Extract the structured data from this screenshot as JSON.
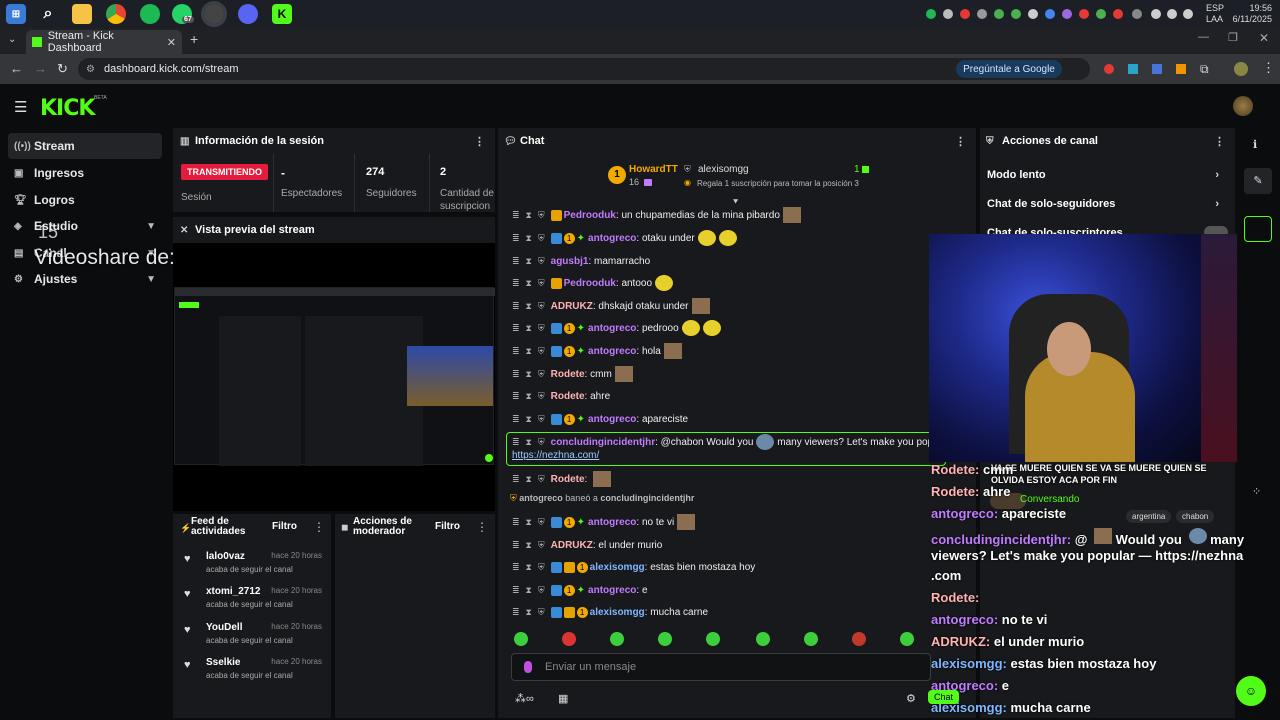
{
  "taskbar": {
    "apps": [
      "windows-logo",
      "search-icon",
      "file-explorer-icon",
      "chrome-icon",
      "spotify-icon",
      "whatsapp-icon",
      "obs-icon",
      "discord-icon",
      "kick-icon"
    ],
    "whatsapp_badge": "67",
    "lang_line1": "ESP",
    "lang_line2": "LAA",
    "time": "19:56",
    "date": "6/11/2025"
  },
  "browser": {
    "tab_title": "Stream - Kick Dashboard",
    "url": "dashboard.kick.com/stream",
    "google_button": "Pregúntale a Google"
  },
  "sidebar": {
    "logo": "KICK",
    "beta": "BETA",
    "items": [
      {
        "label": "Stream",
        "icon": "broadcast-icon"
      },
      {
        "label": "Ingresos",
        "icon": "revenue-icon"
      },
      {
        "label": "Logros",
        "icon": "trophy-icon"
      },
      {
        "label": "Estudio",
        "icon": "studio-icon"
      },
      {
        "label": "Canal",
        "icon": "channel-icon"
      },
      {
        "label": "Ajustes",
        "icon": "settings-icon"
      }
    ],
    "overlay_text": "Videoshare de:",
    "overlay_num": "15"
  },
  "session": {
    "title": "Información de la sesión",
    "live_badge": "TRANSMITIENDO",
    "session_label": "Sesión",
    "spectators_value": "-",
    "spectators_label": "Espectadores",
    "followers_value": "274",
    "followers_label": "Seguidores",
    "subs_value": "2",
    "subs_label_1": "Cantidad de",
    "subs_label_2": "suscripcion"
  },
  "preview": {
    "title": "Vista previa del stream"
  },
  "feed": {
    "title_1": "Feed de",
    "title_2": "actividades",
    "filter": "Filtro",
    "items": [
      {
        "name": "lalo0vaz",
        "time": "hace 20 horas",
        "desc": "acaba de seguir el canal"
      },
      {
        "name": "xtomi_2712",
        "time": "hace 20 horas",
        "desc": "acaba de seguir el canal"
      },
      {
        "name": "YouDell",
        "time": "hace 20 horas",
        "desc": "acaba de seguir el canal"
      },
      {
        "name": "Sselkie",
        "time": "hace 20 horas",
        "desc": "acaba de seguir el canal"
      }
    ]
  },
  "modactions": {
    "title_1": "Acciones de",
    "title_2": "moderador",
    "filter": "Filtro"
  },
  "chat": {
    "title": "Chat",
    "top_gifter": {
      "rank": "1",
      "name": "HowardTT",
      "count": "16",
      "name2": "alexisomgg",
      "count2": "1",
      "promo": "Regala 1 suscripción para tomar la posición 3"
    },
    "messages": [
      {
        "user": "Pedrooduk",
        "color": "#c17bff",
        "text": "un chupamedias de la mina pibardo"
      },
      {
        "user": "antogreco",
        "color": "#c17bff",
        "text": "otaku under"
      },
      {
        "user": "agusbj1",
        "color": "#c17bff",
        "text": "mamarracho"
      },
      {
        "user": "Pedrooduk",
        "color": "#c17bff",
        "text": "antooo"
      },
      {
        "user": "ADRUKZ",
        "color": "#ffb3b3",
        "text": "dhskajd otaku under"
      },
      {
        "user": "antogreco",
        "color": "#c17bff",
        "text": "pedrooo"
      },
      {
        "user": "antogreco",
        "color": "#c17bff",
        "text": "hola"
      },
      {
        "user": "Rodete",
        "color": "#ffb3b3",
        "text": "cmm"
      },
      {
        "user": "Rodete",
        "color": "#ffb3b3",
        "text": "ahre"
      },
      {
        "user": "antogreco",
        "color": "#c17bff",
        "text": "apareciste"
      },
      {
        "user": "concludingincidentjhr",
        "color": "#c17bff",
        "text": "@chabon Would you",
        "text2": "many viewers? Let's make you popular —",
        "link": "https://nezhna.com/"
      },
      {
        "user": "Rodete",
        "color": "#ffb3b3",
        "text": ""
      },
      {
        "user": "antogreco",
        "color": "#c17bff",
        "text": "no te vi"
      },
      {
        "user": "ADRUKZ",
        "color": "#ffb3b3",
        "text": "el under murio"
      },
      {
        "user": "alexisomgg",
        "color": "#7fb7ff",
        "text": "estas bien mostaza hoy"
      },
      {
        "user": "antogreco",
        "color": "#c17bff",
        "text": "e"
      },
      {
        "user": "alexisomgg",
        "color": "#7fb7ff",
        "text": "mucha carne"
      }
    ],
    "ban_actor": "antogreco",
    "ban_text": "baneó a",
    "ban_target": "concludingincidentjhr",
    "input_placeholder": "Enviar un mensaje"
  },
  "actions": {
    "title": "Acciones de canal",
    "items": [
      "Modo lento",
      "Chat de solo-seguidores",
      "Chat de solo-suscriptores"
    ]
  },
  "overlay": {
    "caption_1": "VA SE MUERE QUIEN SE VA SE MUERE QUIEN SE",
    "caption_2": "OLVIDA ESTOY ACA POR FIN",
    "status": "Conversando",
    "tags": [
      "argentina",
      "chabon"
    ],
    "chat_btn": "Chat",
    "lines": [
      {
        "user": "Rodete:",
        "text": "cmm",
        "color": "#ffb3b3"
      },
      {
        "user": "Rodete:",
        "text": "ahre",
        "color": "#ffb3b3"
      },
      {
        "user": "antogreco:",
        "text": "apareciste",
        "color": "#c17bff"
      },
      {
        "user": "concludingincidentjhr:",
        "text": "@",
        "color": "#c17bff"
      },
      {
        "user": "",
        "text": "viewers? Let's make you popular — https://nezhna",
        "color": "#fff"
      },
      {
        "user": "",
        "text": ".com",
        "color": "#fff"
      },
      {
        "user": "Rodete:",
        "text": "",
        "color": "#ffb3b3"
      },
      {
        "user": "antogreco:",
        "text": "no te vi",
        "color": "#c17bff"
      },
      {
        "user": "ADRUKZ:",
        "text": "el under murio",
        "color": "#ffb3b3"
      },
      {
        "user": "alexisomgg:",
        "text": "estas bien mostaza hoy",
        "color": "#7fb7ff"
      },
      {
        "user": "antogreco:",
        "text": "e",
        "color": "#c17bff"
      },
      {
        "user": "alexisomgg:",
        "text": "mucha carne",
        "color": "#7fb7ff"
      }
    ],
    "would_you": "Would you",
    "many": "many"
  }
}
